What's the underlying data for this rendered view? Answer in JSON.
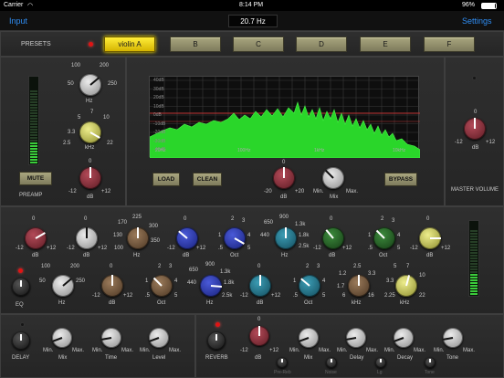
{
  "status": {
    "carrier": "Carrier",
    "time": "8:14 PM",
    "battery": "96%"
  },
  "nav": {
    "left": "Input",
    "right": "Settings",
    "frequency": "20.7 Hz"
  },
  "presets": {
    "label": "PRESETS",
    "buttons": [
      "violin A",
      "B",
      "C",
      "D",
      "E",
      "F"
    ],
    "active": "violin A"
  },
  "preamp": {
    "gain_labels": [
      "100",
      "200",
      "50",
      "250",
      "Hz"
    ],
    "freq_labels": [
      "5",
      "7",
      "3.3",
      "10",
      "2.5",
      "22",
      "kHz"
    ],
    "level_labels": [
      "0",
      "-12",
      "+12",
      "dB"
    ],
    "mute": "MUTE",
    "label": "PREAMP"
  },
  "analyzer": {
    "db_labels": [
      "40dB",
      "30dB",
      "20dB",
      "10dB",
      "0dB",
      "-10dB",
      "-20dB",
      "-30dB",
      "-40dB"
    ],
    "freq_labels": [
      "20Hz",
      "100Hz",
      "1kHz",
      "10kHz"
    ]
  },
  "controls": {
    "load": "LOAD",
    "clean": "CLEAN",
    "gain_labels": [
      "0",
      "-20",
      "+20",
      "dB"
    ],
    "mix_labels": [
      "Min.",
      "Max.",
      "Mix"
    ],
    "bypass": "BYPASS"
  },
  "master": {
    "labels": [
      "0",
      "-12",
      "+12",
      "dB"
    ],
    "title": "MASTER VOLUME"
  },
  "eq": {
    "label": "EQ",
    "row1": [
      {
        "type": "gain",
        "labels": [
          "0",
          "-12",
          "+12",
          "dB"
        ]
      },
      {
        "type": "gain",
        "labels": [
          "0",
          "-12",
          "+12",
          "dB"
        ]
      },
      {
        "type": "freq",
        "labels": [
          "170",
          "225",
          "130",
          "300",
          "100",
          "350",
          "Hz"
        ]
      },
      {
        "type": "gain",
        "labels": [
          "0",
          "-12",
          "+12",
          "dB"
        ]
      },
      {
        "type": "oct",
        "labels": [
          "2",
          "3",
          "1",
          "4",
          ".5",
          "5",
          "Oct"
        ]
      },
      {
        "type": "freq",
        "labels": [
          "650",
          "900",
          "440",
          "1.3k",
          "1.8k",
          "2.5k",
          "Hz"
        ]
      },
      {
        "type": "gain",
        "labels": [
          "0",
          "-12",
          "+12",
          "dB"
        ]
      },
      {
        "type": "oct",
        "labels": [
          "2",
          "3",
          "1",
          "4",
          ".5",
          "5",
          "Oct"
        ]
      },
      {
        "type": "gain",
        "labels": [
          "0",
          "-12",
          "+12",
          "dB"
        ]
      }
    ],
    "row2": [
      {
        "type": "freq",
        "labels": [
          "100",
          "200",
          "50",
          "250",
          "Hz"
        ]
      },
      {
        "type": "gain",
        "labels": [
          "0",
          "-12",
          "+12",
          "dB"
        ]
      },
      {
        "type": "oct",
        "labels": [
          "2",
          "3",
          "1",
          "4",
          ".5",
          "5",
          "Oct"
        ]
      },
      {
        "type": "freq",
        "labels": [
          "650",
          "900",
          "440",
          "1.3k",
          "1.8k",
          "2.5k",
          "Hz"
        ]
      },
      {
        "type": "gain",
        "labels": [
          "0",
          "-12",
          "+12",
          "dB"
        ]
      },
      {
        "type": "oct",
        "labels": [
          "2",
          "3",
          "1",
          "4",
          ".5",
          "5",
          "Oct"
        ]
      },
      {
        "type": "freq",
        "labels": [
          "2.5",
          "1.2",
          "3.3",
          "1.7",
          "6",
          "16",
          "kHz"
        ]
      },
      {
        "type": "freq",
        "labels": [
          "5",
          "7",
          "3.3",
          "10",
          "2.25",
          "22",
          "kHz"
        ]
      }
    ]
  },
  "delay": {
    "label": "DELAY",
    "knobs": [
      {
        "name": "Mix",
        "min": "Min.",
        "max": "Max."
      },
      {
        "name": "Time",
        "min": "Min.",
        "max": "Max."
      },
      {
        "name": "Level",
        "min": "Min.",
        "max": "Max."
      }
    ]
  },
  "reverb": {
    "label": "REVERB",
    "gain_labels": [
      "0",
      "-12",
      "+12",
      "dB"
    ],
    "knobs": [
      {
        "name": "Mix",
        "min": "Min.",
        "max": "Max."
      },
      {
        "name": "Delay",
        "min": "Min.",
        "max": "Max."
      },
      {
        "name": "Decay",
        "min": "Min.",
        "max": "Max."
      },
      {
        "name": "Tone",
        "min": "Min.",
        "max": "Max."
      }
    ],
    "sub": [
      "Pre-Reb",
      "Noise",
      "Lg",
      "Tone"
    ]
  }
}
